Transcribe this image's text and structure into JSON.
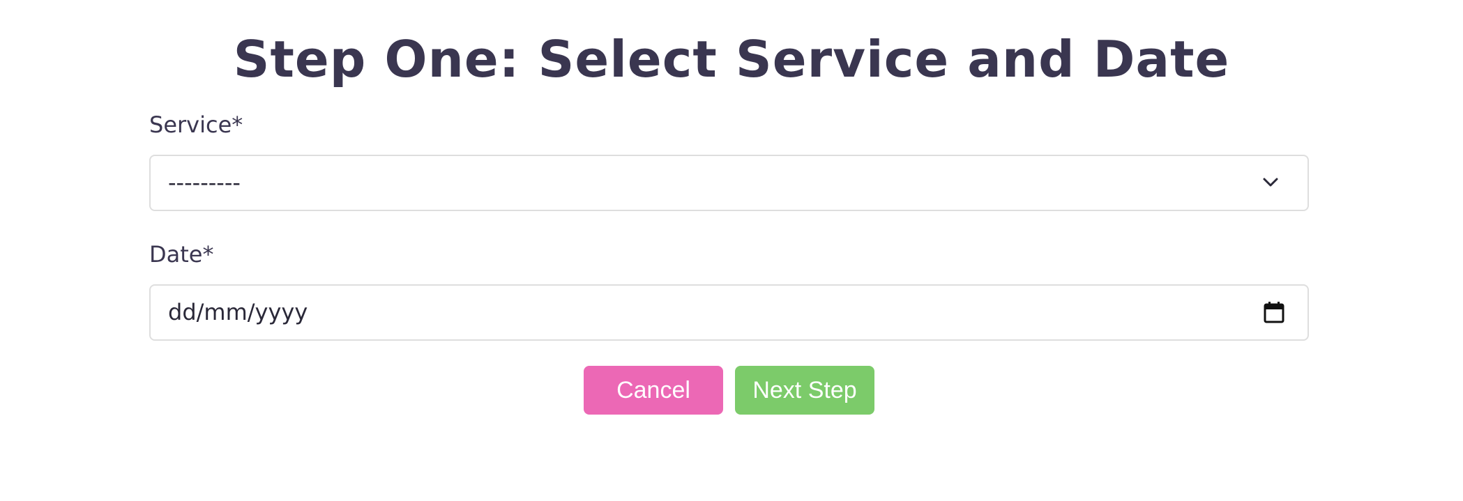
{
  "header": {
    "title": "Step One: Select Service and Date"
  },
  "form": {
    "service": {
      "label": "Service*",
      "selected_value": "---------",
      "icon": "chevron-down-icon"
    },
    "date": {
      "label": "Date*",
      "placeholder": "dd/mm/yyyy",
      "icon": "calendar-icon"
    }
  },
  "actions": {
    "cancel_label": "Cancel",
    "next_label": "Next Step"
  },
  "colors": {
    "text": "#3a3650",
    "cancel": "#ec68b5",
    "next": "#7ccb6a",
    "border": "#dedede"
  }
}
